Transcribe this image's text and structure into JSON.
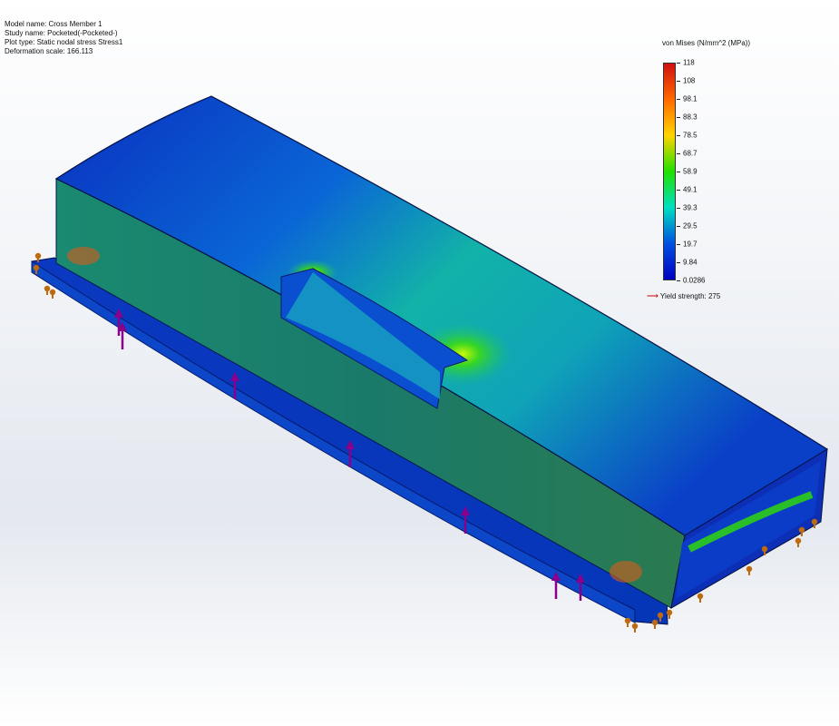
{
  "info": {
    "model_name": "Model name: Cross Member 1",
    "study_name": "Study name: Pocketed(-Pocketed-)",
    "plot_type": "Plot type: Static nodal stress Stress1",
    "deformation_scale": "Deformation scale: 166.113"
  },
  "legend": {
    "title": "von Mises (N/mm^2 (MPa))",
    "ticks": [
      "118",
      "108",
      "98.1",
      "88.3",
      "78.5",
      "68.7",
      "58.9",
      "49.1",
      "39.3",
      "29.5",
      "19.7",
      "9.84",
      "0.0286"
    ],
    "max": 118,
    "min": 0.0286,
    "yield_label": "Yield strength: 275",
    "colors": [
      "#d01010",
      "#ff6a00",
      "#ffd400",
      "#22e000",
      "#00e0c0",
      "#0050e0",
      "#0000c0"
    ]
  },
  "model": {
    "part": "pocketed box cross member",
    "load_arrow_color": "#8b008b",
    "fixture_color": "#c06a10"
  }
}
